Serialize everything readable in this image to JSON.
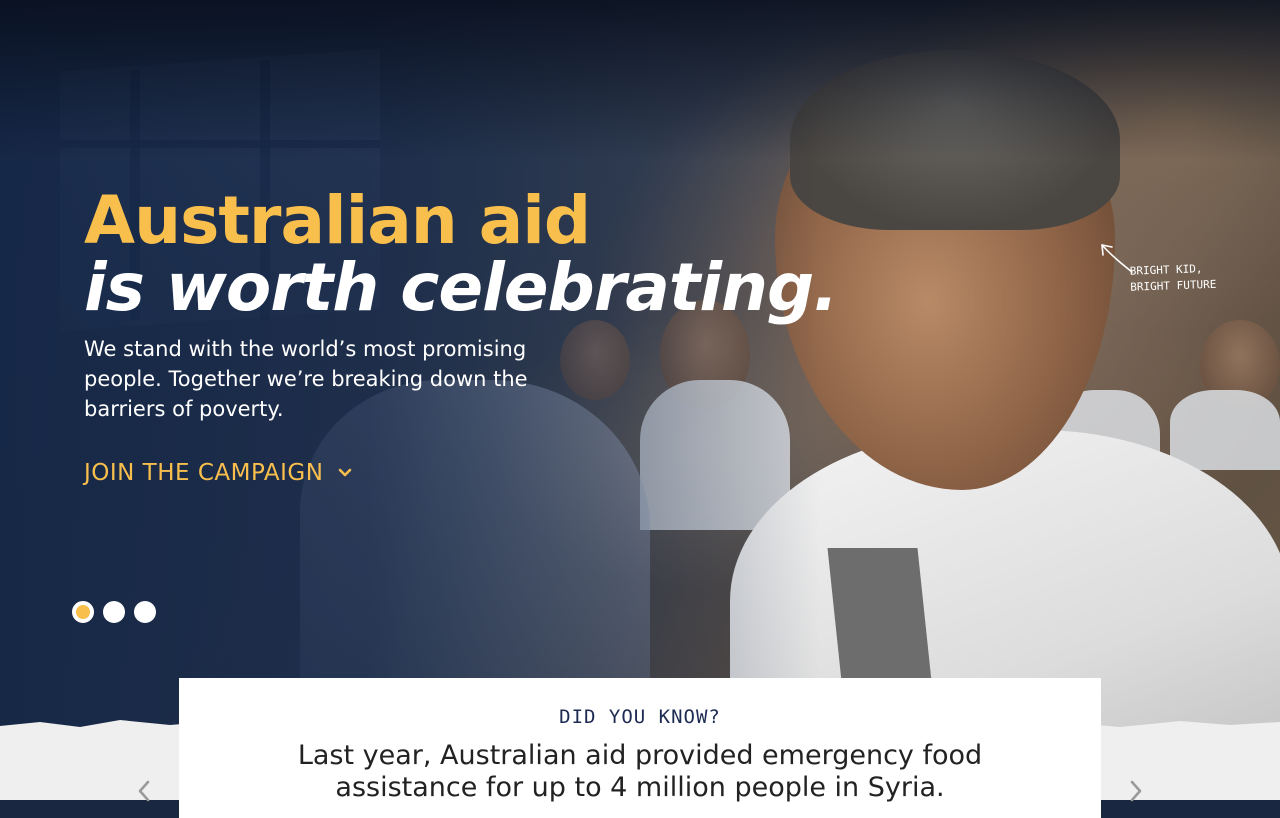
{
  "hero": {
    "headline_line1": "Australian aid",
    "headline_line2": "is worth celebrating.",
    "subtext": "We stand with the world’s most promising people. Together we’re breaking down the barriers of poverty.",
    "cta_label": "JOIN THE CAMPAIGN",
    "cta_icon": "chevron-down-icon",
    "annotation_line1": "BRIGHT KID,",
    "annotation_line2": "BRIGHT FUTURE",
    "slides": {
      "count": 3,
      "active_index": 0
    }
  },
  "facts": {
    "kicker": "DID YOU KNOW?",
    "text": "Last year, Australian aid provided emergency food assistance for up to 4 million people in Syria.",
    "prev_icon": "chevron-left-icon",
    "next_icon": "chevron-right-icon"
  },
  "colors": {
    "accent_yellow": "#f9bf4d",
    "navy_overlay": "#142646",
    "kicker_navy": "#1d2a52",
    "white": "#ffffff",
    "paper": "#efefef"
  }
}
